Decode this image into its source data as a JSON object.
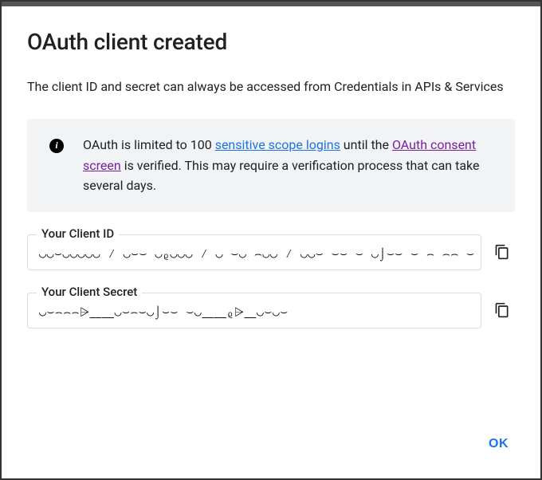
{
  "dialog": {
    "title": "OAuth client created",
    "subtitle": "The client ID and secret can always be accessed from Credentials in APIs & Services",
    "info": {
      "pre": "OAuth is limited to 100 ",
      "link1": "sensitive scope logins",
      "mid": " until the ",
      "link2": "OAuth consent screen",
      "post": " is verified. This may require a verification process that can take several days."
    },
    "fields": {
      "client_id": {
        "label": "Your Client ID",
        "value": "◡◡⌣◡◡◡◡◡ ⁄ ◡⌣⌣   ◡ᵨ◡◡◡ ⁄ ◡ ⌣◡ ⌢◡◡ ⁄ ◡◡⌣ ⌣⌣ ⌣ ◡⌡⌣⌣ ⌣  ⌢ ⌢⌢ ⌣  ◡◡⩥⌢⌢⩥ ⌣◡ᵨᵨ◡ ⌣ ⩥◡"
      },
      "client_secret": {
        "label": "Your Client Secret",
        "value": "◡⌣⌢⌢⌢⩥⎽⎽◡⌣⌢⌣◡⌡⌣⌣  ⌣◡⎽⎽ᵨ⩥⎽◡⌣◡⌣"
      }
    },
    "actions": {
      "ok": "OK"
    }
  }
}
